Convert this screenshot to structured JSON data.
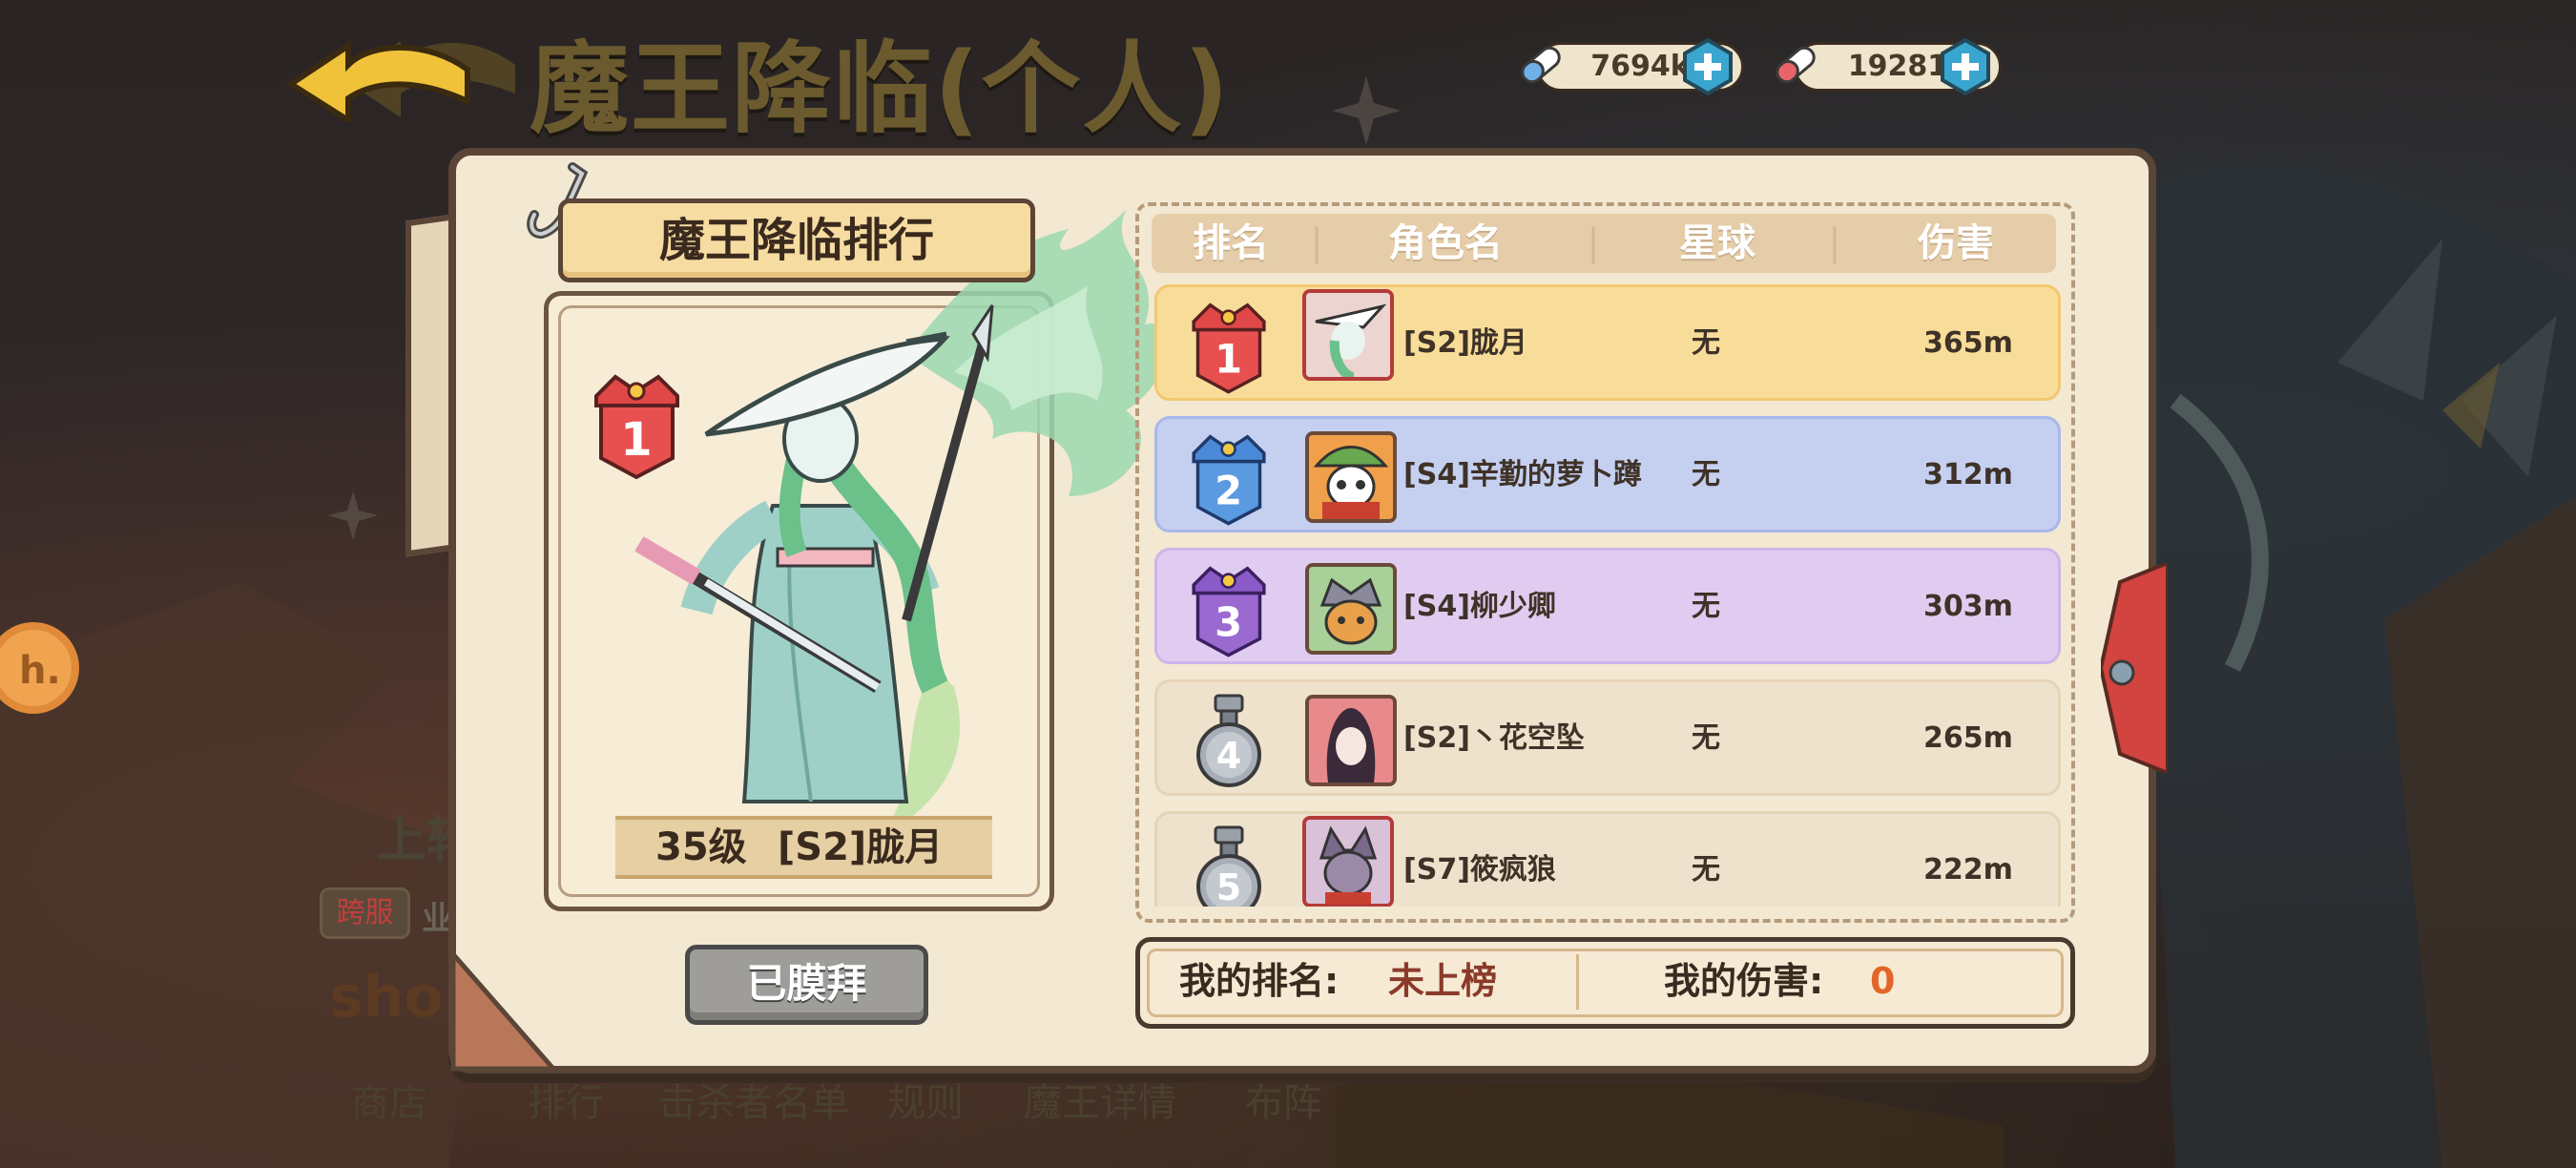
{
  "header": {
    "title": "魔王降临(个人)",
    "resources": [
      {
        "icon": "blue-pill-icon",
        "value": "7694k"
      },
      {
        "icon": "red-pill-icon",
        "value": "19281"
      }
    ]
  },
  "panel": {
    "title": "魔王降临排行",
    "top_player": {
      "level": "35级",
      "name": "[S2]胧月",
      "rank": "1"
    },
    "worship_button": "已膜拜"
  },
  "leaderboard": {
    "columns": [
      "排名",
      "角色名",
      "星球",
      "伤害"
    ],
    "rows": [
      {
        "rank": "1",
        "name": "[S2]胧月",
        "planet": "无",
        "damage": "365m"
      },
      {
        "rank": "2",
        "name": "[S4]辛勤的萝卜蹲",
        "planet": "无",
        "damage": "312m"
      },
      {
        "rank": "3",
        "name": "[S4]柳少卿",
        "planet": "无",
        "damage": "303m"
      },
      {
        "rank": "4",
        "name": "[S2]丶花空坠",
        "planet": "无",
        "damage": "265m"
      },
      {
        "rank": "5",
        "name": "[S7]筱疯狼",
        "planet": "无",
        "damage": "222m"
      }
    ]
  },
  "my_stats": {
    "rank_label": "我的排名:",
    "rank_value": "未上榜",
    "damage_label": "我的伤害:",
    "damage_value": "0"
  },
  "background": {
    "side_title": "上轮",
    "tag": "跨服",
    "tag_text": "业",
    "shop_word": "shop"
  },
  "bottom_nav": [
    "商店",
    "排行",
    "击杀者名单",
    "规则",
    "魔王详情",
    "布阵"
  ],
  "colors": {
    "gold_row": "#f8dd9a",
    "silver_row": "#c5d0f0",
    "bronze_row": "#e0ccf0",
    "plain_row": "#efe2cc",
    "my_rank_value": "#8b3a2a",
    "my_damage_value": "#e2662a"
  }
}
